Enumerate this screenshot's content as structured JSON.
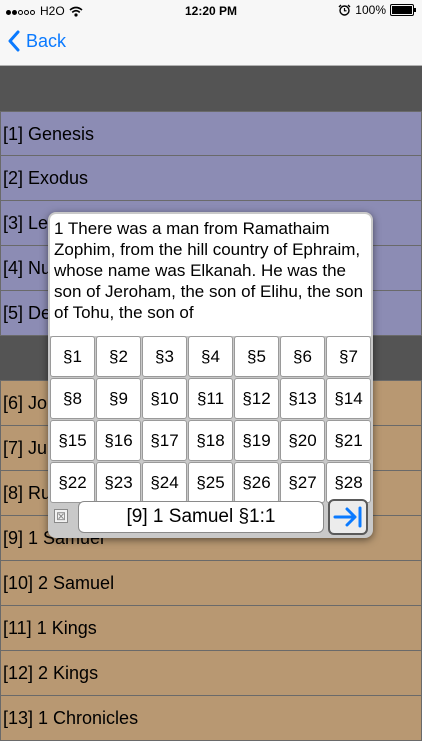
{
  "status_bar": {
    "carrier": "H2O",
    "time": "12:20 PM",
    "battery": "100%",
    "signal_icon": "signal-dots-icon",
    "wifi_icon": "wifi-icon",
    "alarm_icon": "alarm-icon"
  },
  "nav": {
    "back_label": "Back"
  },
  "books": [
    {
      "label": "[1] Genesis"
    },
    {
      "label": "[2] Exodus"
    },
    {
      "label": "[3] Le"
    },
    {
      "label": "[4] Nu"
    },
    {
      "label": "[5] De"
    },
    {
      "label": ""
    },
    {
      "label": "[6] Jo"
    },
    {
      "label": "[7] Ju"
    },
    {
      "label": "[8] Ru"
    },
    {
      "label": "[9] 1 Samuel"
    },
    {
      "label": "[10] 2 Samuel"
    },
    {
      "label": "[11] 1 Kings"
    },
    {
      "label": "[12] 2 Kings"
    },
    {
      "label": "[13] 1 Chronicles"
    }
  ],
  "popup": {
    "verse_text": "1 There was a man from Ramathaim Zophim, from the hill country of Ephraim, whose name was Elkanah. He was the son of Jeroham, the son of Elihu, the son of Tohu, the son of",
    "chapters": [
      "§1",
      "§2",
      "§3",
      "§4",
      "§5",
      "§6",
      "§7",
      "§8",
      "§9",
      "§10",
      "§11",
      "§12",
      "§13",
      "§14",
      "§15",
      "§16",
      "§17",
      "§18",
      "§19",
      "§20",
      "§21",
      "§22",
      "§23",
      "§24",
      "§25",
      "§26",
      "§27",
      "§28"
    ],
    "reference": "[9] 1 Samuel §1:1",
    "clear_symbol": "⊠",
    "go_icon": "arrow-right-to-bar-icon"
  },
  "colors": {
    "accent": "#0a7aff",
    "purple_row": "#8c8cb4",
    "tan_row": "#b89872",
    "dark_band": "#545454"
  }
}
